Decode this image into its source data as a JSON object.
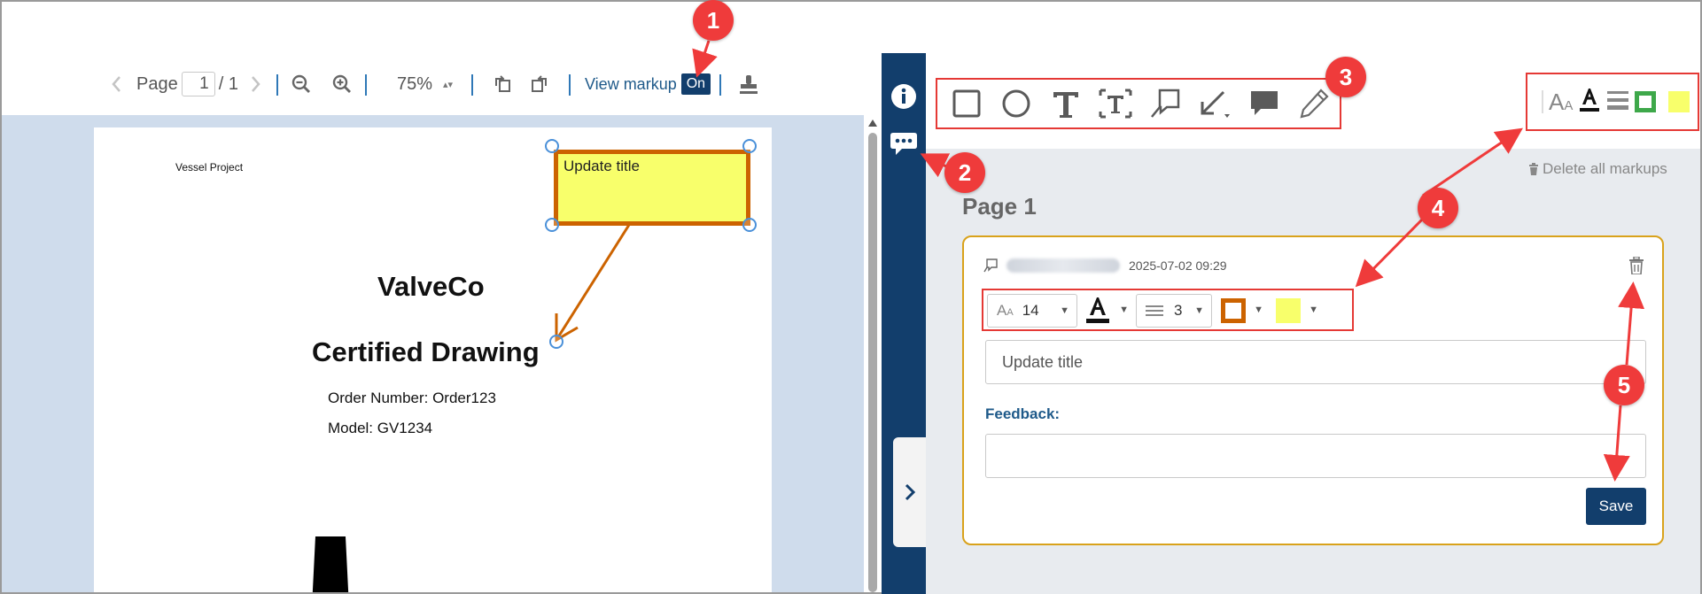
{
  "toolbar": {
    "page_label": "Page",
    "page_current": "1",
    "page_total": "/ 1",
    "zoom": "75%",
    "view_markup_label": "View markup",
    "view_markup_state": "On"
  },
  "document": {
    "header_text": "Vessel Project",
    "company": "ValveCo",
    "doc_title": "Certified Drawing",
    "order_line": "Order Number: Order123",
    "model_line": "Model: GV1234",
    "markup_text": "Update title"
  },
  "annotation_tools": [
    "rectangle-icon",
    "ellipse-icon",
    "text-icon",
    "text-box-icon",
    "callout-icon",
    "arrow-icon",
    "comment-icon",
    "pencil-icon"
  ],
  "style_tools": [
    "font-size-icon",
    "font-color-icon",
    "line-width-icon",
    "border-color-icon",
    "fill-color-icon"
  ],
  "panel": {
    "delete_all_label": "Delete all markups",
    "page_heading": "Page 1",
    "markup": {
      "timestamp": "2025-07-02 09:29",
      "font_size": "14",
      "line_width": "3",
      "title_value": "Update title",
      "feedback_label": "Feedback:",
      "feedback_value": "",
      "save_label": "Save"
    }
  },
  "callouts": [
    "1",
    "2",
    "3",
    "4",
    "5"
  ],
  "colors": {
    "navy": "#123e6c",
    "markup_fill": "#f8ff6b",
    "markup_border": "#cc6300",
    "card_border": "#d9a21b",
    "highlight": "#e53935",
    "callout": "#ef3b3b",
    "viewer_bg": "#cfdcec"
  }
}
